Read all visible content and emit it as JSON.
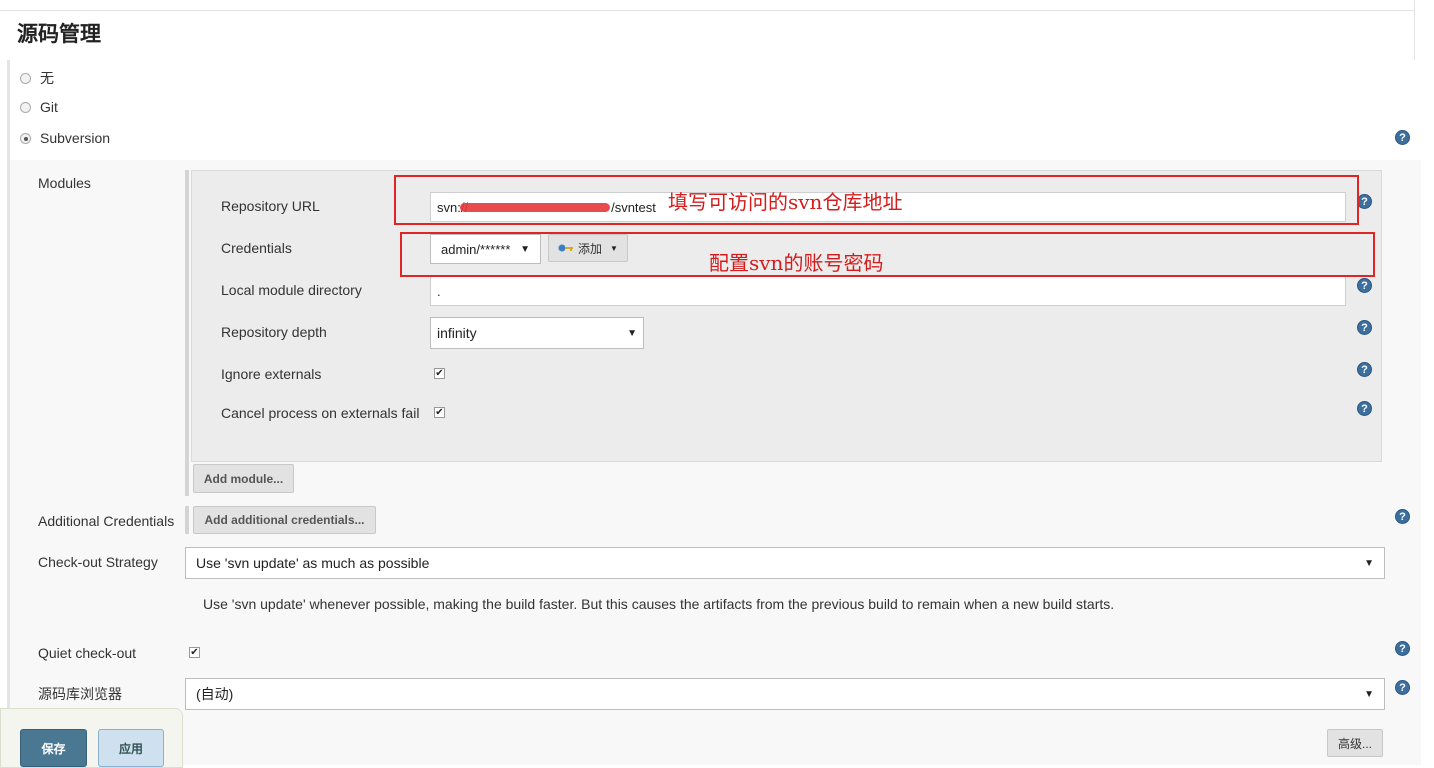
{
  "section": {
    "title": "源码管理"
  },
  "scm_options": [
    {
      "label": "无",
      "checked": false
    },
    {
      "label": "Git",
      "checked": false
    },
    {
      "label": "Subversion",
      "checked": true
    }
  ],
  "modules": {
    "label": "Modules",
    "repository_url": {
      "label": "Repository URL",
      "value": "svn://",
      "value_suffix": "/svntest"
    },
    "credentials": {
      "label": "Credentials",
      "selected": "admin/******",
      "add_button": "添加"
    },
    "local_module_directory": {
      "label": "Local module directory",
      "value": "."
    },
    "repository_depth": {
      "label": "Repository depth",
      "selected": "infinity"
    },
    "ignore_externals": {
      "label": "Ignore externals",
      "checked": true
    },
    "cancel_process": {
      "label": "Cancel process on externals fail",
      "checked": true
    },
    "add_module_button": "Add module..."
  },
  "additional_credentials": {
    "label": "Additional Credentials",
    "button": "Add additional credentials..."
  },
  "checkout_strategy": {
    "label": "Check-out Strategy",
    "selected": "Use 'svn update' as much as possible",
    "description": "Use 'svn update' whenever possible, making the build faster. But this causes the artifacts from the previous build to remain when a new build starts."
  },
  "quiet_checkout": {
    "label": "Quiet check-out",
    "checked": true
  },
  "repo_browser": {
    "label": "源码库浏览器",
    "selected": "(自动)"
  },
  "advanced_button": "高级...",
  "footer": {
    "save": "保存",
    "apply": "应用"
  },
  "annotations": {
    "url_note": "填写可访问的svn仓库地址",
    "cred_note": "配置svn的账号密码"
  },
  "icons": {
    "help": "help-icon",
    "key": "key-icon",
    "dropdown": "chevron-down-icon"
  },
  "colors": {
    "annotation": "#e02525",
    "help": "#3d6f9e",
    "save": "#4a7892"
  },
  "help_glyph": "?",
  "check_glyph": "✔",
  "arrow_glyph": "▼"
}
